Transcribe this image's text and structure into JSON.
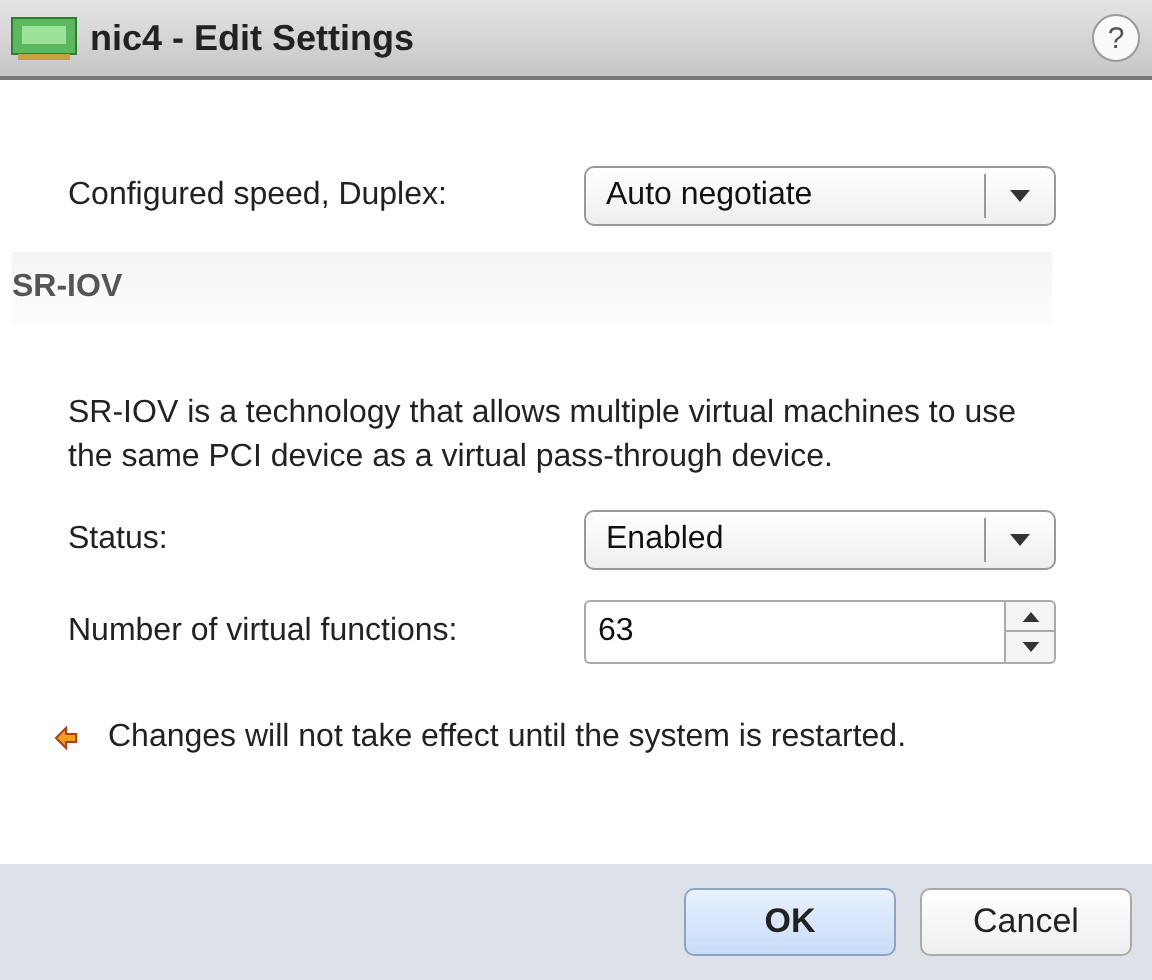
{
  "window": {
    "title": "nic4 - Edit Settings",
    "help": "?"
  },
  "speed": {
    "label": "Configured speed, Duplex:",
    "value": "Auto negotiate"
  },
  "section": {
    "title": "SR-IOV",
    "description": "SR-IOV is a technology that allows multiple virtual machines to use the same PCI device as a virtual pass-through device."
  },
  "fields": [
    {
      "kind": "select",
      "label": "Status:",
      "value": "Enabled"
    },
    {
      "kind": "spinner",
      "label": "Number of virtual functions:",
      "value": "63"
    }
  ],
  "note": "Changes will not take effect until the system is restarted.",
  "buttons": [
    {
      "label": "OK",
      "default": true
    },
    {
      "label": "Cancel",
      "default": false
    }
  ]
}
